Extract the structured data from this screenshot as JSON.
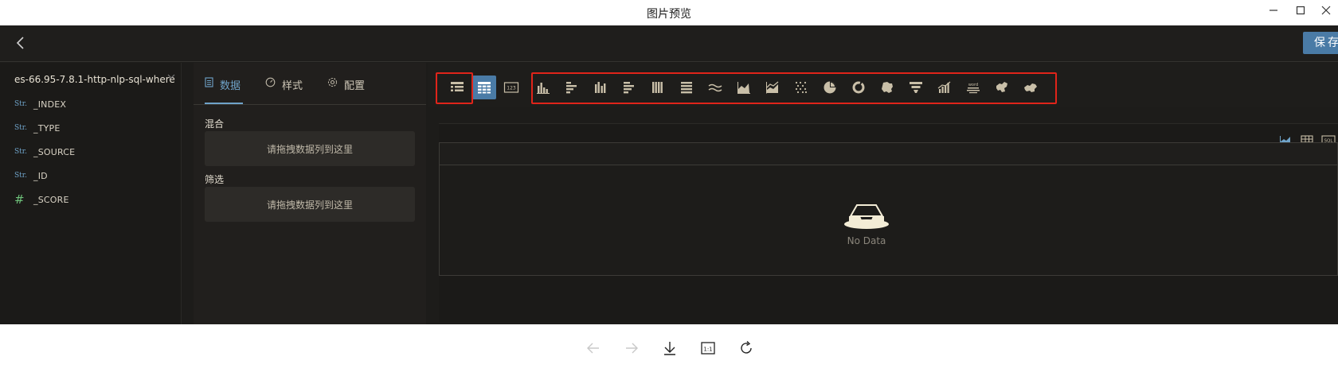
{
  "window": {
    "title": "图片预览",
    "min_icon": "minimize-icon",
    "max_icon": "maximize-icon",
    "close_icon": "close-icon"
  },
  "header": {
    "back_icon": "chevron-left-icon",
    "save_label": "保存"
  },
  "field_panel": {
    "datasource": "es-66.95-7.8.1-http-nlp-sql-where",
    "fields": [
      {
        "type": "Str.",
        "name": "_INDEX"
      },
      {
        "type": "Str.",
        "name": "_TYPE"
      },
      {
        "type": "Str.",
        "name": "_SOURCE"
      },
      {
        "type": "Str.",
        "name": "_ID"
      },
      {
        "type": "#",
        "name": "_SCORE"
      }
    ]
  },
  "config_panel": {
    "tabs": [
      {
        "label": "数据",
        "icon": "document-icon",
        "active": true
      },
      {
        "label": "样式",
        "icon": "gauge-icon",
        "active": false
      },
      {
        "label": "配置",
        "icon": "gear-icon",
        "active": false
      }
    ],
    "mix_label": "混合",
    "filter_label": "筛选",
    "drop_hint": "请拖拽数据列到这里"
  },
  "chart_toolbar": {
    "left_group": [
      "list-table-icon",
      "grid-table-icon",
      "number-card-icon"
    ],
    "active_index": 1,
    "chart_types": [
      "bar-chart-icon",
      "horizontal-bar-icon",
      "grouped-bar-icon",
      "stacked-horizontal-bar-icon",
      "stacked-bar-icon",
      "percent-horizontal-bar-icon",
      "line-icon",
      "area-chart-icon",
      "stacked-area-icon",
      "scatter-icon",
      "pie-icon",
      "donut-icon",
      "map-icon",
      "funnel-icon",
      "combo-chart-icon",
      "word-cloud-icon",
      "china-map-icon",
      "region-map-icon"
    ],
    "word_cloud_text": "word"
  },
  "preview": {
    "view_icons": [
      "area-chart-icon",
      "table-icon",
      "sql-icon"
    ],
    "sql_label": "SQL",
    "empty_text": "No Data"
  },
  "bottom_bar": {
    "prev_icon": "arrow-left-icon",
    "next_icon": "arrow-right-icon",
    "download_icon": "download-icon",
    "actual_size_label": "1:1",
    "rotate_icon": "rotate-icon"
  },
  "colors": {
    "accent": "#4a7ba6",
    "highlight_box": "#e0241a",
    "icon": "#c9bfa8"
  }
}
